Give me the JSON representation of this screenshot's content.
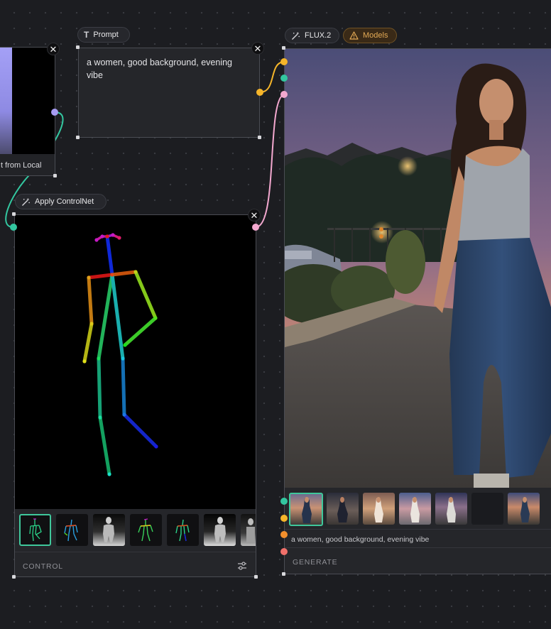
{
  "prompt_node": {
    "label": "Prompt",
    "text": "a women, good background, evening vibe"
  },
  "local_node": {
    "button_label": "t from Local"
  },
  "controlnet_node": {
    "label": "Apply ControlNet",
    "footer_label": "CONTROL"
  },
  "flux_node": {
    "label": "FLUX.2",
    "models_label": "Models",
    "prompt_preview": "a women, good background, evening vibe",
    "footer_label": "GENERATE"
  },
  "colors": {
    "canvas_bg": "#1c1d21",
    "port_yellow": "#f5b52a",
    "port_teal": "#33c7a0",
    "port_pink": "#f3a8cf",
    "port_orange": "#f28f2c",
    "port_red": "#f0706a",
    "port_purple": "#a79cf2",
    "models_accent": "#e2a955"
  },
  "icons": {
    "prompt": "text-T-icon",
    "controlnet": "magic-wand-icon",
    "flux": "magic-wand-icon",
    "models": "warning-triangle-icon",
    "close": "close-x-icon",
    "settings": "sliders-icon"
  }
}
